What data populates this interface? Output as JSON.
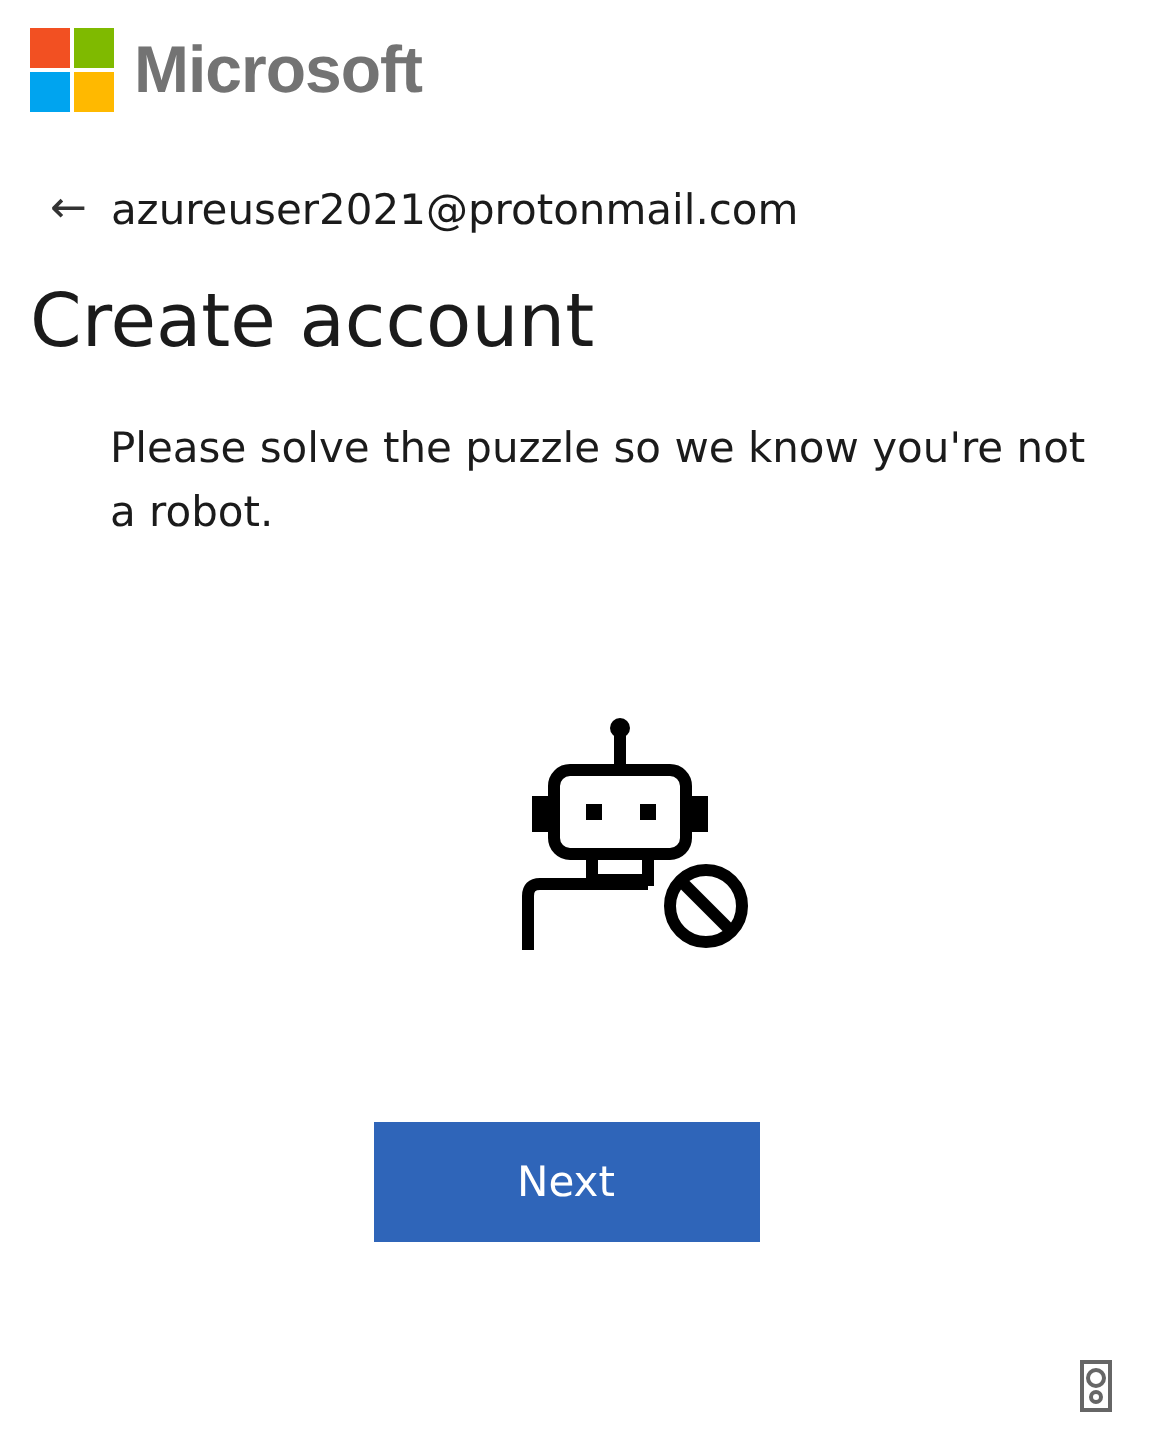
{
  "brand": {
    "name": "Microsoft"
  },
  "identity": {
    "back_glyph": "←",
    "email": "azureuser2021@protonmail.com"
  },
  "title": "Create account",
  "instruction": "Please solve the puzzle so we know you're not a robot.",
  "buttons": [
    {
      "label": "Next",
      "kind": "primary"
    }
  ]
}
